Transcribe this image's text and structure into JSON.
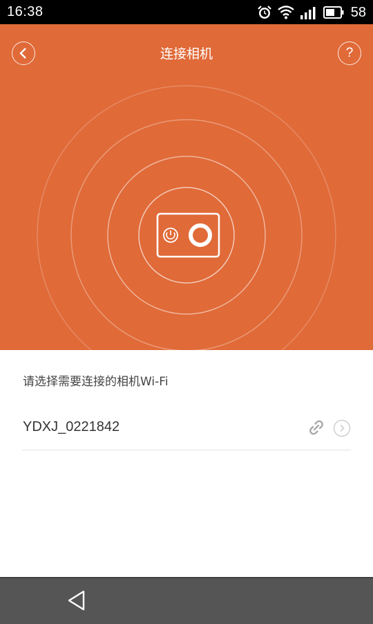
{
  "status_bar": {
    "time": "16:38",
    "battery": "58",
    "icons": [
      "alarm-icon",
      "wifi-icon",
      "signal-icon",
      "battery-icon"
    ]
  },
  "header": {
    "title": "连接相机",
    "back_icon": "chevron-left-icon",
    "help_label": "?"
  },
  "hero": {
    "background_color": "#e06a38",
    "illustration": "camera-icon"
  },
  "main": {
    "hint": "请选择需要连接的相机Wi-Fi",
    "networks": [
      {
        "name": "YDXJ_0221842",
        "status_icon": "link-icon",
        "action_icon": "chevron-right-icon"
      }
    ]
  },
  "nav_bar": {
    "back_icon": "triangle-back-icon"
  }
}
